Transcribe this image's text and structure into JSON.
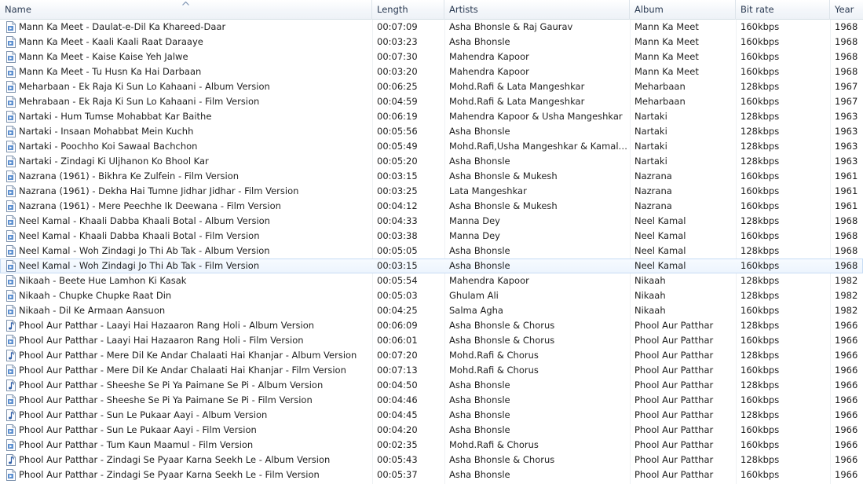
{
  "columns": {
    "name": "Name",
    "length": "Length",
    "artists": "Artists",
    "album": "Album",
    "bitrate": "Bit rate",
    "year": "Year"
  },
  "sort": {
    "column": "Name",
    "direction": "ascending"
  },
  "icons": {
    "wma": "wma-file-icon",
    "mp3": "music-note-file-icon"
  },
  "rows": [
    {
      "name": "Mann Ka Meet - Daulat-e-Dil Ka Khareed-Daar",
      "length": "00:07:09",
      "artists": "Asha Bhonsle & Raj Gaurav",
      "album": "Mann Ka Meet",
      "bitrate": "160kbps",
      "year": "1968",
      "icon": "wma"
    },
    {
      "name": "Mann Ka Meet - Kaali Kaali Raat Daraaye",
      "length": "00:03:23",
      "artists": "Asha Bhonsle",
      "album": "Mann Ka Meet",
      "bitrate": "160kbps",
      "year": "1968",
      "icon": "wma"
    },
    {
      "name": "Mann Ka Meet - Kaise Kaise Yeh Jalwe",
      "length": "00:07:30",
      "artists": "Mahendra Kapoor",
      "album": "Mann Ka Meet",
      "bitrate": "160kbps",
      "year": "1968",
      "icon": "wma"
    },
    {
      "name": "Mann Ka Meet - Tu Husn Ka Hai Darbaan",
      "length": "00:03:20",
      "artists": "Mahendra Kapoor",
      "album": "Mann Ka Meet",
      "bitrate": "160kbps",
      "year": "1968",
      "icon": "wma"
    },
    {
      "name": "Meharbaan - Ek Raja Ki Sun Lo Kahaani - Album Version",
      "length": "00:06:25",
      "artists": "Mohd.Rafi & Lata Mangeshkar",
      "album": "Meharbaan",
      "bitrate": "128kbps",
      "year": "1967",
      "icon": "wma"
    },
    {
      "name": "Mehrabaan - Ek Raja Ki Sun Lo Kahaani - Film Version",
      "length": "00:04:59",
      "artists": "Mohd.Rafi & Lata Mangeshkar",
      "album": "Meharbaan",
      "bitrate": "160kbps",
      "year": "1967",
      "icon": "wma"
    },
    {
      "name": "Nartaki - Hum Tumse Mohabbat Kar Baithe",
      "length": "00:06:19",
      "artists": "Mahendra Kapoor & Usha Mangeshkar",
      "album": "Nartaki",
      "bitrate": "128kbps",
      "year": "1963",
      "icon": "wma"
    },
    {
      "name": "Nartaki - Insaan Mohabbat Mein Kuchh",
      "length": "00:05:56",
      "artists": "Asha Bhonsle",
      "album": "Nartaki",
      "bitrate": "128kbps",
      "year": "1963",
      "icon": "wma"
    },
    {
      "name": "Nartaki - Poochho Koi Sawaal Bachchon",
      "length": "00:05:49",
      "artists": "Mohd.Rafi,Usha Mangeshkar & Kamal B...",
      "album": "Nartaki",
      "bitrate": "128kbps",
      "year": "1963",
      "icon": "wma"
    },
    {
      "name": "Nartaki - Zindagi Ki Uljhanon Ko Bhool Kar",
      "length": "00:05:20",
      "artists": "Asha Bhonsle",
      "album": "Nartaki",
      "bitrate": "128kbps",
      "year": "1963",
      "icon": "wma"
    },
    {
      "name": "Nazrana (1961) - Bikhra Ke Zulfein - Film Version",
      "length": "00:03:15",
      "artists": "Asha Bhonsle & Mukesh",
      "album": "Nazrana",
      "bitrate": "160kbps",
      "year": "1961",
      "icon": "wma"
    },
    {
      "name": "Nazrana (1961) - Dekha Hai Tumne Jidhar Jidhar - Film Version",
      "length": "00:03:25",
      "artists": "Lata Mangeshkar",
      "album": "Nazrana",
      "bitrate": "160kbps",
      "year": "1961",
      "icon": "wma"
    },
    {
      "name": "Nazrana (1961) - Mere Peechhe Ik Deewana - Film Version",
      "length": "00:04:12",
      "artists": "Asha Bhonsle & Mukesh",
      "album": "Nazrana",
      "bitrate": "160kbps",
      "year": "1961",
      "icon": "wma"
    },
    {
      "name": "Neel Kamal - Khaali Dabba Khaali Botal - Album Version",
      "length": "00:04:33",
      "artists": "Manna Dey",
      "album": "Neel Kamal",
      "bitrate": "128kbps",
      "year": "1968",
      "icon": "wma"
    },
    {
      "name": "Neel Kamal - Khaali Dabba Khaali Botal - Film Version",
      "length": "00:03:38",
      "artists": "Manna Dey",
      "album": "Neel Kamal",
      "bitrate": "160kbps",
      "year": "1968",
      "icon": "wma"
    },
    {
      "name": "Neel Kamal - Woh Zindagi Jo Thi Ab Tak - Album Version",
      "length": "00:05:05",
      "artists": "Asha Bhonsle",
      "album": "Neel Kamal",
      "bitrate": "128kbps",
      "year": "1968",
      "icon": "wma"
    },
    {
      "name": "Neel Kamal - Woh Zindagi Jo Thi Ab Tak - Film Version",
      "length": "00:03:15",
      "artists": "Asha Bhonsle",
      "album": "Neel Kamal",
      "bitrate": "160kbps",
      "year": "1968",
      "icon": "wma",
      "hover": true
    },
    {
      "name": "Nikaah - Beete Hue Lamhon Ki Kasak",
      "length": "00:05:54",
      "artists": "Mahendra Kapoor",
      "album": "Nikaah",
      "bitrate": "128kbps",
      "year": "1982",
      "icon": "wma"
    },
    {
      "name": "Nikaah - Chupke Chupke Raat Din",
      "length": "00:05:03",
      "artists": "Ghulam Ali",
      "album": "Nikaah",
      "bitrate": "128kbps",
      "year": "1982",
      "icon": "wma"
    },
    {
      "name": "Nikaah - Dil Ke Armaan Aansuon",
      "length": "00:04:25",
      "artists": "Salma Agha",
      "album": "Nikaah",
      "bitrate": "160kbps",
      "year": "1982",
      "icon": "wma"
    },
    {
      "name": "Phool Aur Patthar - Laayi Hai Hazaaron Rang Holi - Album Version",
      "length": "00:06:09",
      "artists": "Asha Bhonsle & Chorus",
      "album": "Phool Aur Patthar",
      "bitrate": "128kbps",
      "year": "1966",
      "icon": "mp3"
    },
    {
      "name": "Phool Aur Patthar - Laayi Hai Hazaaron Rang Holi - Film Version",
      "length": "00:06:01",
      "artists": "Asha Bhonsle & Chorus",
      "album": "Phool Aur Patthar",
      "bitrate": "160kbps",
      "year": "1966",
      "icon": "wma"
    },
    {
      "name": "Phool Aur Patthar - Mere Dil Ke Andar Chalaati Hai Khanjar - Album Version",
      "length": "00:07:20",
      "artists": "Mohd.Rafi & Chorus",
      "album": "Phool Aur Patthar",
      "bitrate": "128kbps",
      "year": "1966",
      "icon": "mp3"
    },
    {
      "name": "Phool Aur Patthar - Mere Dil Ke Andar Chalaati Hai Khanjar - Film Version",
      "length": "00:07:13",
      "artists": "Mohd.Rafi & Chorus",
      "album": "Phool Aur Patthar",
      "bitrate": "160kbps",
      "year": "1966",
      "icon": "wma"
    },
    {
      "name": "Phool Aur Patthar - Sheeshe Se Pi Ya Paimane Se Pi - Album Version",
      "length": "00:04:50",
      "artists": "Asha Bhonsle",
      "album": "Phool Aur Patthar",
      "bitrate": "128kbps",
      "year": "1966",
      "icon": "mp3"
    },
    {
      "name": "Phool Aur Patthar - Sheeshe Se Pi Ya Paimane Se Pi - Film Version",
      "length": "00:04:46",
      "artists": "Asha Bhonsle",
      "album": "Phool Aur Patthar",
      "bitrate": "160kbps",
      "year": "1966",
      "icon": "wma"
    },
    {
      "name": "Phool Aur Patthar - Sun Le Pukaar Aayi - Album Version",
      "length": "00:04:45",
      "artists": "Asha Bhonsle",
      "album": "Phool Aur Patthar",
      "bitrate": "128kbps",
      "year": "1966",
      "icon": "mp3"
    },
    {
      "name": "Phool Aur Patthar - Sun Le Pukaar Aayi - Film Version",
      "length": "00:04:20",
      "artists": "Asha Bhonsle",
      "album": "Phool Aur Patthar",
      "bitrate": "160kbps",
      "year": "1966",
      "icon": "wma"
    },
    {
      "name": "Phool Aur Patthar - Tum Kaun Maamul - Film Version",
      "length": "00:02:35",
      "artists": "Mohd.Rafi & Chorus",
      "album": "Phool Aur Patthar",
      "bitrate": "160kbps",
      "year": "1966",
      "icon": "wma"
    },
    {
      "name": "Phool Aur Patthar - Zindagi Se Pyaar Karna Seekh Le - Album Version",
      "length": "00:05:43",
      "artists": "Asha Bhonsle & Chorus",
      "album": "Phool Aur Patthar",
      "bitrate": "128kbps",
      "year": "1966",
      "icon": "mp3"
    },
    {
      "name": "Phool Aur Patthar - Zindagi Se Pyaar Karna Seekh Le - Film Version",
      "length": "00:05:37",
      "artists": "Asha Bhonsle",
      "album": "Phool Aur Patthar",
      "bitrate": "160kbps",
      "year": "1966",
      "icon": "wma"
    }
  ]
}
